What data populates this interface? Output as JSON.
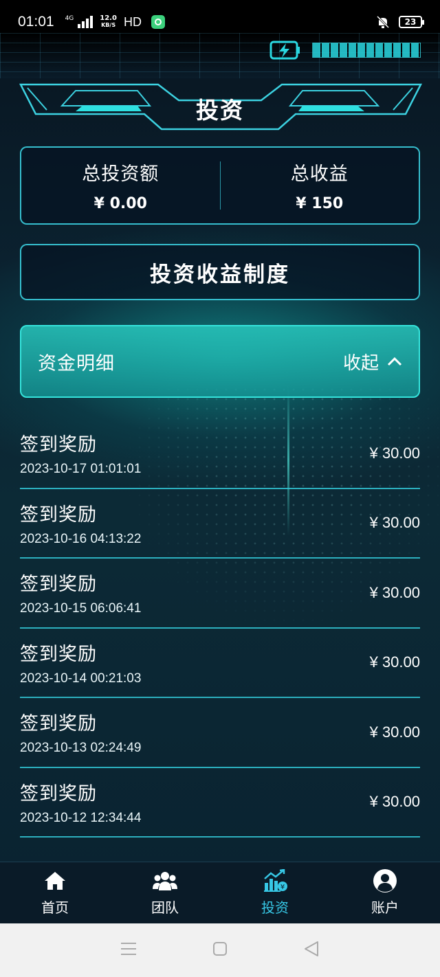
{
  "status_bar": {
    "time": "01:01",
    "network": "4G",
    "speed_value": "12.0",
    "speed_unit": "KB/S",
    "hd": "HD",
    "battery": "23"
  },
  "header": {
    "title": "投资"
  },
  "summary": {
    "total_invest_label": "总投资额",
    "total_invest_value": "¥ 0.00",
    "total_income_label": "总收益",
    "total_income_value": "¥ 150"
  },
  "policy_button": {
    "label": "投资收益制度"
  },
  "details": {
    "title": "资金明细",
    "toggle_label": "收起",
    "records": [
      {
        "name": "签到奖励",
        "time": "2023-10-17 01:01:01",
        "amount": "¥ 30.00"
      },
      {
        "name": "签到奖励",
        "time": "2023-10-16 04:13:22",
        "amount": "¥ 30.00"
      },
      {
        "name": "签到奖励",
        "time": "2023-10-15 06:06:41",
        "amount": "¥ 30.00"
      },
      {
        "name": "签到奖励",
        "time": "2023-10-14 00:21:03",
        "amount": "¥ 30.00"
      },
      {
        "name": "签到奖励",
        "time": "2023-10-13 02:24:49",
        "amount": "¥ 30.00"
      },
      {
        "name": "签到奖励",
        "time": "2023-10-12 12:34:44",
        "amount": "¥ 30.00"
      }
    ]
  },
  "tabbar": {
    "items": [
      {
        "label": "首页",
        "icon": "home-icon"
      },
      {
        "label": "团队",
        "icon": "team-icon"
      },
      {
        "label": "投资",
        "icon": "invest-chart-icon"
      },
      {
        "label": "账户",
        "icon": "account-icon"
      }
    ],
    "active_index": 2
  },
  "colors": {
    "accent": "#37c8e6",
    "border": "#3cd2e1",
    "background": "#0b2230"
  }
}
